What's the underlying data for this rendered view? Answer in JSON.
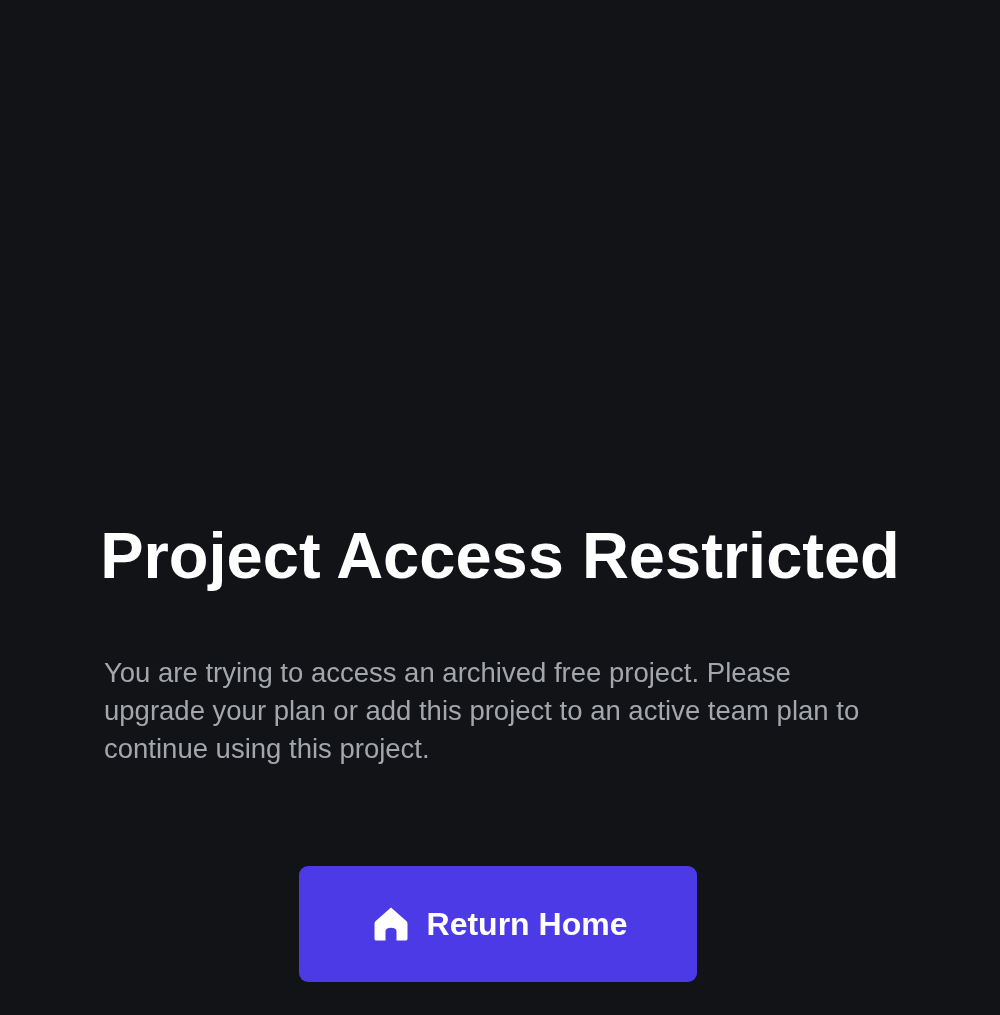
{
  "title": "Project Access Restricted",
  "message": "You are trying to access an archived free project. Please upgrade your plan or add this project to an active team plan to continue using this project.",
  "button": {
    "label": "Return Home"
  }
}
